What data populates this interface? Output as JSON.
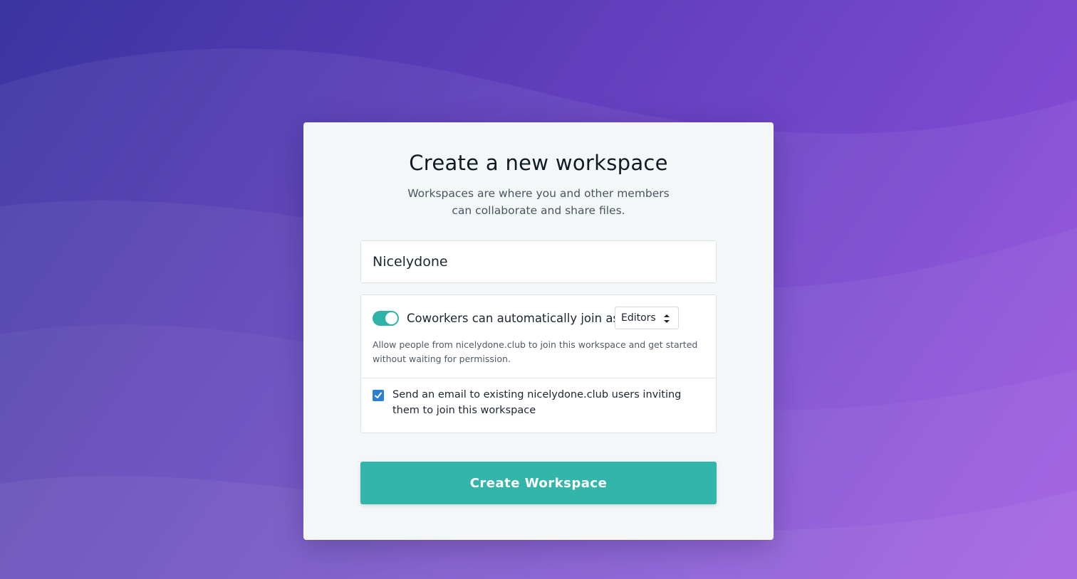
{
  "colors": {
    "background_start": "#3b34a0",
    "background_end": "#9a4fe0",
    "card": "#f4f7f8",
    "accent": "#34b5a9",
    "checkbox": "#2b7fd6"
  },
  "form": {
    "title": "Create a new workspace",
    "subtitle": "Workspaces are where you and other members can collaborate and share files.",
    "workspace_name_value": "Nicelydone",
    "auto_join": {
      "enabled": true,
      "label": "Coworkers can automatically join as",
      "role_selected": "Editors",
      "role_icon": "chevron-up-down-icon",
      "help_text": "Allow people from nicelydone.club to join this workspace and get started without waiting for permission."
    },
    "send_email": {
      "checked": true,
      "label": "Send an email to existing nicelydone.club users inviting them to join this workspace"
    },
    "submit_label": "Create Workspace"
  }
}
